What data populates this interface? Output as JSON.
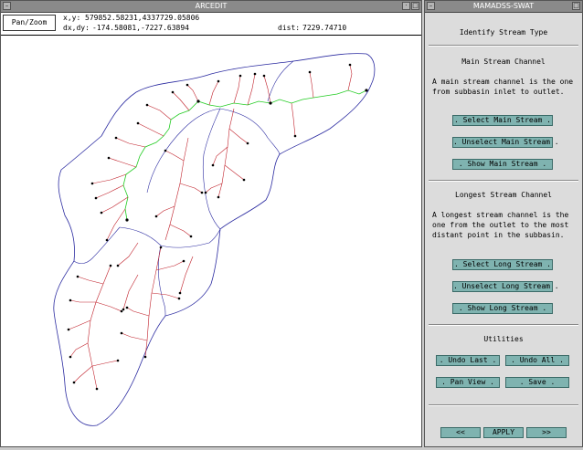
{
  "arcedit": {
    "title": "ARCEDIT",
    "panzoom_label": "Pan/Zoom",
    "xy_label": "x,y:",
    "xy_value": "579852.58231,4337729.05806",
    "dxdy_label": "dx,dy:",
    "dxdy_value": "-174.58081,-7227.63894",
    "dist_label": "dist:",
    "dist_value": "7229.74710"
  },
  "panel": {
    "title": "MAMADSS-SWAT",
    "heading": "Identify Stream Type",
    "main": {
      "title": "Main Stream Channel",
      "desc": "A main stream channel is the one from subbasin inlet to outlet.",
      "select": ". Select Main Stream .",
      "unselect": ". Unselect Main Stream .",
      "show": ". Show Main Stream ."
    },
    "longest": {
      "title": "Longest Stream Channel",
      "desc": "A longest stream channel is the one from the outlet to the most distant point in the subbasin.",
      "select": ". Select Long Stream .",
      "unselect": ". Unselect Long Stream .",
      "show": ". Show Long Stream ."
    },
    "utilities": {
      "title": "Utilities",
      "undo_last": ". Undo Last .",
      "undo_all": ". Undo  All .",
      "pan_view": ". Pan View .",
      "save": ". Save ."
    },
    "nav": {
      "prev": "<<",
      "apply": "APPLY",
      "next": ">>"
    }
  },
  "colors": {
    "boundary": "#2a2aa0",
    "stream": "#c0202a",
    "main_stream": "#22cc22",
    "button": "#7fb3b0",
    "titlebar": "#8a8a8a"
  }
}
